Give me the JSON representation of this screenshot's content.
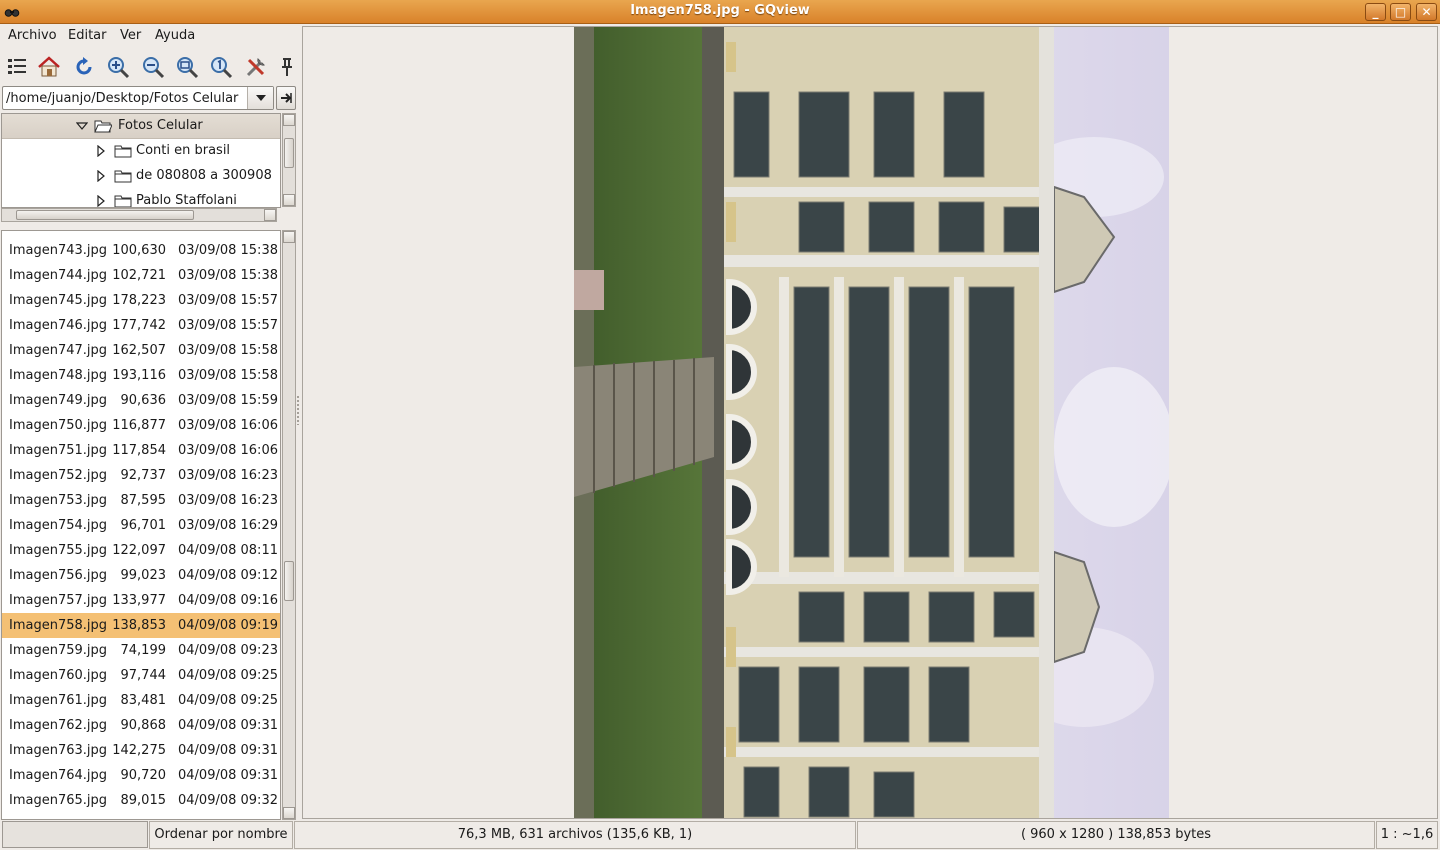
{
  "window": {
    "title": "Imagen758.jpg - GQview",
    "minimize": "_",
    "maximize": "□",
    "close": "✕"
  },
  "menu": [
    {
      "label": "Archivo"
    },
    {
      "label": "Editar"
    },
    {
      "label": "Ver"
    },
    {
      "label": "Ayuda"
    }
  ],
  "toolbar": {
    "icons": [
      "thumbnails-icon",
      "home-icon",
      "refresh-icon",
      "zoom-in-icon",
      "zoom-out-icon",
      "zoom-fit-icon",
      "zoom-1to1-icon",
      "configure-icon",
      "float-icon"
    ]
  },
  "path": {
    "value": "/home/juanjo/Desktop/Fotos Celular"
  },
  "tree": {
    "root": "Fotos Celular",
    "children": [
      "Conti en brasil",
      "de 080808 a 300908",
      "Pablo Staffolani"
    ]
  },
  "files": [
    {
      "name": "Imagen743.jpg",
      "size": "100,630",
      "date": "03/09/08 15:38"
    },
    {
      "name": "Imagen744.jpg",
      "size": "102,721",
      "date": "03/09/08 15:38"
    },
    {
      "name": "Imagen745.jpg",
      "size": "178,223",
      "date": "03/09/08 15:57"
    },
    {
      "name": "Imagen746.jpg",
      "size": "177,742",
      "date": "03/09/08 15:57"
    },
    {
      "name": "Imagen747.jpg",
      "size": "162,507",
      "date": "03/09/08 15:58"
    },
    {
      "name": "Imagen748.jpg",
      "size": "193,116",
      "date": "03/09/08 15:58"
    },
    {
      "name": "Imagen749.jpg",
      "size": "90,636",
      "date": "03/09/08 15:59"
    },
    {
      "name": "Imagen750.jpg",
      "size": "116,877",
      "date": "03/09/08 16:06"
    },
    {
      "name": "Imagen751.jpg",
      "size": "117,854",
      "date": "03/09/08 16:06"
    },
    {
      "name": "Imagen752.jpg",
      "size": "92,737",
      "date": "03/09/08 16:23"
    },
    {
      "name": "Imagen753.jpg",
      "size": "87,595",
      "date": "03/09/08 16:23"
    },
    {
      "name": "Imagen754.jpg",
      "size": "96,701",
      "date": "03/09/08 16:29"
    },
    {
      "name": "Imagen755.jpg",
      "size": "122,097",
      "date": "04/09/08 08:11"
    },
    {
      "name": "Imagen756.jpg",
      "size": "99,023",
      "date": "04/09/08 09:12"
    },
    {
      "name": "Imagen757.jpg",
      "size": "133,977",
      "date": "04/09/08 09:16"
    },
    {
      "name": "Imagen758.jpg",
      "size": "138,853",
      "date": "04/09/08 09:19",
      "selected": true
    },
    {
      "name": "Imagen759.jpg",
      "size": "74,199",
      "date": "04/09/08 09:23"
    },
    {
      "name": "Imagen760.jpg",
      "size": "97,744",
      "date": "04/09/08 09:25"
    },
    {
      "name": "Imagen761.jpg",
      "size": "83,481",
      "date": "04/09/08 09:25"
    },
    {
      "name": "Imagen762.jpg",
      "size": "90,868",
      "date": "04/09/08 09:31"
    },
    {
      "name": "Imagen763.jpg",
      "size": "142,275",
      "date": "04/09/08 09:31"
    },
    {
      "name": "Imagen764.jpg",
      "size": "90,720",
      "date": "04/09/08 09:31"
    },
    {
      "name": "Imagen765.jpg",
      "size": "89,015",
      "date": "04/09/08 09:32"
    }
  ],
  "status": {
    "sort": "Ordenar por nombre",
    "summary": "76,3 MB, 631 archivos (135,6 KB, 1)",
    "image_info": "( 960 x 1280 ) 138,853 bytes",
    "zoom": "1 : ~1,6"
  },
  "colors": {
    "titlebar": "#d9822a",
    "selection": "#f4c074"
  }
}
